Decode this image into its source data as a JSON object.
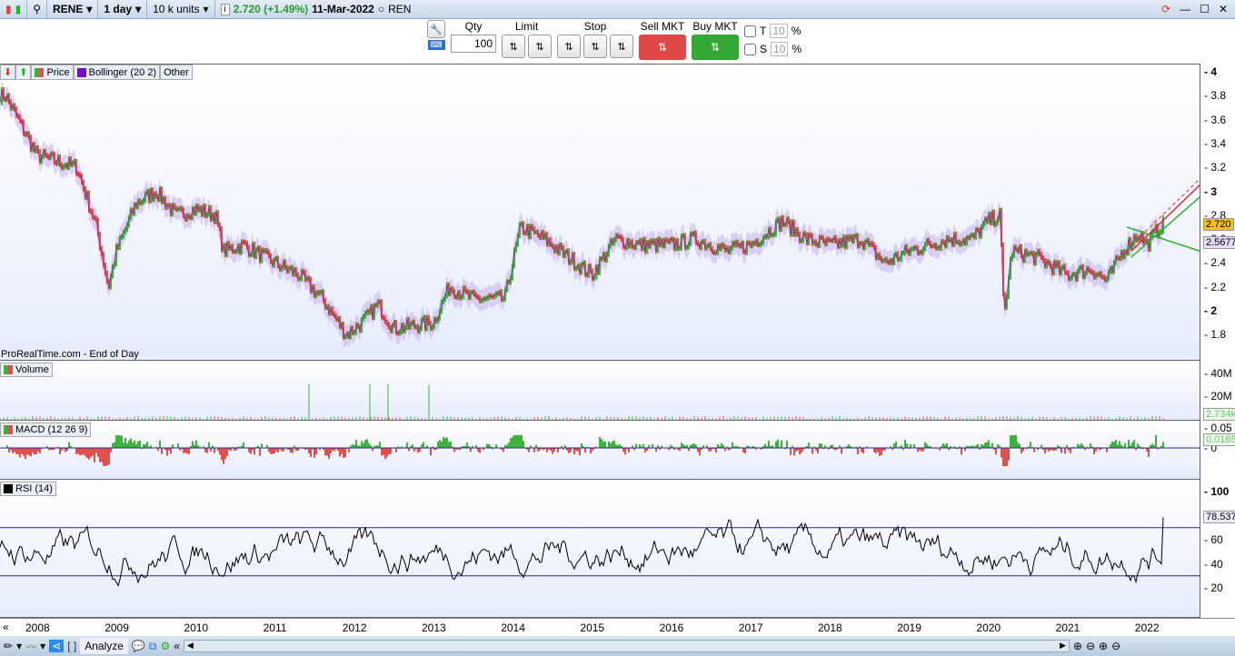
{
  "topbar": {
    "symbol": "RENE",
    "timeframe": "1 day",
    "units": "10 k units",
    "price": "2.720 (+1.49%)",
    "date": "11-Mar-2022",
    "exchange": "REN"
  },
  "trading": {
    "qty_label": "Qty",
    "qty_value": "100",
    "limit_label": "Limit",
    "stop_label": "Stop",
    "sell_label": "Sell MKT",
    "buy_label": "Buy MKT",
    "t_label": "T",
    "s_label": "S",
    "t_value": "10",
    "s_value": "10",
    "percent": "%"
  },
  "legend": {
    "price": "Price",
    "bollinger": "Bollinger (20 2)",
    "other": "Other",
    "volume": "Volume",
    "macd": "MACD (12 26 9)",
    "rsi": "RSI (14)"
  },
  "source": "ProRealTime.com - End of Day",
  "bottombar": {
    "analyze": "Analyze"
  },
  "colors": {
    "up": "#3cb43c",
    "down": "#e05050",
    "bollinger": "#9b59d0",
    "hline": "#2a2a8a"
  },
  "chart_data": [
    {
      "type": "line",
      "title": "Price",
      "yticks": [
        "4",
        "3.8",
        "3.6",
        "3.4",
        "3.2",
        "3",
        "2.8",
        "2.6",
        "2.4",
        "2.2",
        "2",
        "1.8"
      ],
      "ylim": [
        1.7,
        4.05
      ],
      "xticks": [
        "2008",
        "2009",
        "2010",
        "2011",
        "2012",
        "2013",
        "2014",
        "2015",
        "2016",
        "2017",
        "2018",
        "2019",
        "2020",
        "2021",
        "2022"
      ],
      "x": [
        2007.6,
        2008.0,
        2008.5,
        2008.75,
        2008.9,
        2009.0,
        2009.25,
        2009.5,
        2009.75,
        2010.0,
        2010.25,
        2010.35,
        2010.6,
        2011.0,
        2011.3,
        2011.6,
        2011.9,
        2012.1,
        2012.3,
        2012.5,
        2012.8,
        2013.0,
        2013.2,
        2013.5,
        2013.9,
        2014.0,
        2014.1,
        2014.4,
        2014.7,
        2015.0,
        2015.3,
        2015.6,
        2016.0,
        2016.3,
        2016.7,
        2017.0,
        2017.4,
        2017.7,
        2018.0,
        2018.4,
        2018.7,
        2019.0,
        2019.5,
        2019.8,
        2020.0,
        2020.15,
        2020.2,
        2020.3,
        2020.6,
        2021.0,
        2021.3,
        2021.5,
        2021.7,
        2021.9,
        2022.0,
        2022.19
      ],
      "y": [
        3.8,
        3.3,
        3.2,
        2.7,
        2.2,
        2.5,
        2.9,
        3.0,
        2.8,
        2.85,
        2.8,
        2.5,
        2.55,
        2.4,
        2.3,
        2.1,
        1.8,
        1.9,
        2.05,
        1.85,
        1.88,
        1.9,
        2.2,
        2.1,
        2.1,
        2.4,
        2.7,
        2.6,
        2.45,
        2.3,
        2.6,
        2.55,
        2.55,
        2.6,
        2.5,
        2.55,
        2.75,
        2.6,
        2.55,
        2.6,
        2.4,
        2.5,
        2.6,
        2.6,
        2.75,
        2.8,
        1.95,
        2.5,
        2.45,
        2.3,
        2.35,
        2.25,
        2.5,
        2.65,
        2.55,
        2.72
      ],
      "last_price": "2.720",
      "bollinger_last": "2.5677"
    },
    {
      "type": "bar",
      "title": "Volume",
      "yticks": [
        "40M",
        "20M"
      ],
      "last": "2.734k"
    },
    {
      "type": "bar",
      "title": "MACD (12 26 9)",
      "yticks": [
        "0.05",
        "0"
      ],
      "last": "0.0165"
    },
    {
      "type": "line",
      "title": "RSI (14)",
      "yticks": [
        "100",
        "80",
        "60",
        "40",
        "20"
      ],
      "ylim": [
        10,
        100
      ],
      "levels": [
        70,
        30
      ],
      "last": "78.537"
    }
  ]
}
